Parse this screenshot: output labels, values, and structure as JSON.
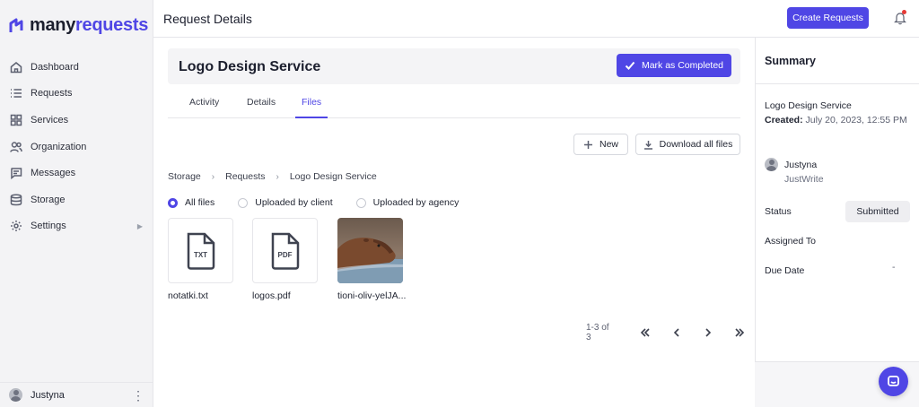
{
  "brand": {
    "part1": "many",
    "part2": "requests",
    "color": "#4f46e5"
  },
  "sidebar": {
    "items": [
      {
        "label": "Dashboard",
        "icon": "home-icon"
      },
      {
        "label": "Requests",
        "icon": "list-icon"
      },
      {
        "label": "Services",
        "icon": "grid-icon"
      },
      {
        "label": "Organization",
        "icon": "people-icon"
      },
      {
        "label": "Messages",
        "icon": "chat-icon"
      },
      {
        "label": "Storage",
        "icon": "database-icon"
      },
      {
        "label": "Settings",
        "icon": "gear-icon"
      }
    ],
    "user": "Justyna"
  },
  "topbar": {
    "title": "Request Details",
    "create_label": "Create Requests"
  },
  "request": {
    "name": "Logo Design Service",
    "complete_label": "Mark as Completed"
  },
  "tabs": [
    {
      "label": "Activity",
      "active": false
    },
    {
      "label": "Details",
      "active": false
    },
    {
      "label": "Files",
      "active": true
    }
  ],
  "actions": {
    "new_label": "New",
    "download_label": "Download all files"
  },
  "breadcrumb": [
    "Storage",
    "Requests",
    "Logo Design Service"
  ],
  "filters": [
    {
      "label": "All files",
      "selected": true
    },
    {
      "label": "Uploaded by client",
      "selected": false
    },
    {
      "label": "Uploaded by agency",
      "selected": false
    }
  ],
  "files": [
    {
      "name": "notatki.txt",
      "type": "TXT"
    },
    {
      "name": "logos.pdf",
      "type": "PDF"
    },
    {
      "name": "tioni-oliv-yelJA...",
      "type": "image"
    }
  ],
  "pagination": {
    "range": "1-3 of 3"
  },
  "summary": {
    "heading": "Summary",
    "title": "Logo Design Service",
    "created_label": "Created:",
    "created_value": "July 20, 2023, 12:55 PM",
    "user": "Justyna",
    "company": "JustWrite",
    "status_label": "Status",
    "status_value": "Submitted",
    "assigned_label": "Assigned To",
    "due_label": "Due Date",
    "due_value": "-"
  }
}
